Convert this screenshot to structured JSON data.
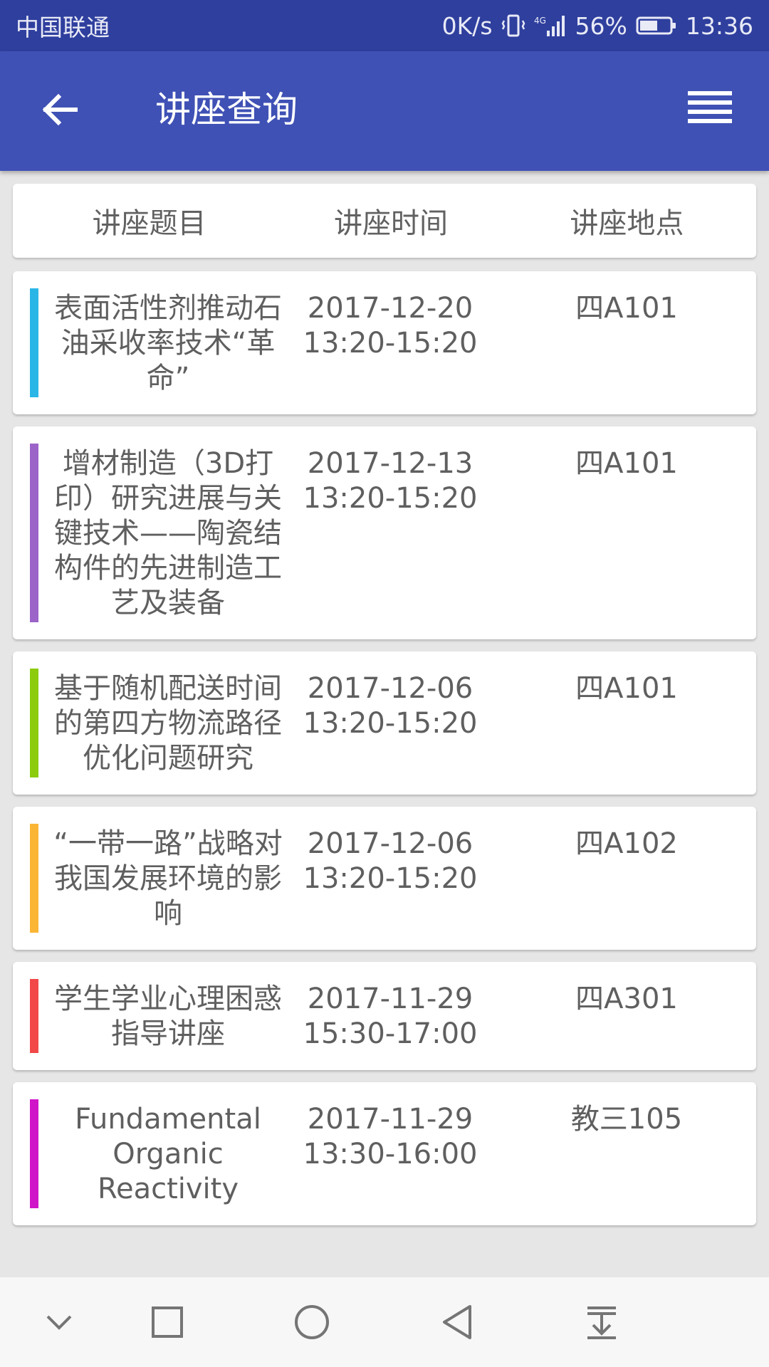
{
  "status_bar": {
    "carrier": "中国联通",
    "net_speed": "0K/s",
    "battery": "56%",
    "time": "13:36"
  },
  "app_bar": {
    "title": "讲座查询"
  },
  "table_header": {
    "title_col": "讲座题目",
    "time_col": "讲座时间",
    "place_col": "讲座地点"
  },
  "lectures": [
    {
      "title": "表面活性剂推动石油采收率技术“革命”",
      "date": "2017-12-20",
      "time": "13:20-15:20",
      "place": "四A101",
      "color": "#29b6e6"
    },
    {
      "title": "增材制造（3D打印）研究进展与关键技术——陶瓷结构件的先进制造工艺及装备",
      "date": "2017-12-13",
      "time": "13:20-15:20",
      "place": "四A101",
      "color": "#9c63c9"
    },
    {
      "title": "基于随机配送时间的第四方物流路径优化问题研究",
      "date": "2017-12-06",
      "time": "13:20-15:20",
      "place": "四A101",
      "color": "#8ccc0c"
    },
    {
      "title": "“一带一路”战略对我国发展环境的影响",
      "date": "2017-12-06",
      "time": "13:20-15:20",
      "place": "四A102",
      "color": "#fbb534"
    },
    {
      "title": "学生学业心理困惑指导讲座",
      "date": "2017-11-29",
      "time": "15:30-17:00",
      "place": "四A301",
      "color": "#f24848"
    },
    {
      "title": "Fundamental Organic Reactivity",
      "date": "2017-11-29",
      "time": "13:30-16:00",
      "place": "教三105",
      "color": "#d014c8"
    }
  ],
  "icons": {
    "back": "arrow-left-icon",
    "menu": "hamburger-menu-icon",
    "nav": [
      "chevron-down-icon",
      "square-icon",
      "circle-icon",
      "triangle-back-icon",
      "pull-down-icon"
    ]
  },
  "colors": {
    "status_bar": "#2f3f9e",
    "app_bar": "#3f51b5",
    "background": "#e6e6e6"
  }
}
